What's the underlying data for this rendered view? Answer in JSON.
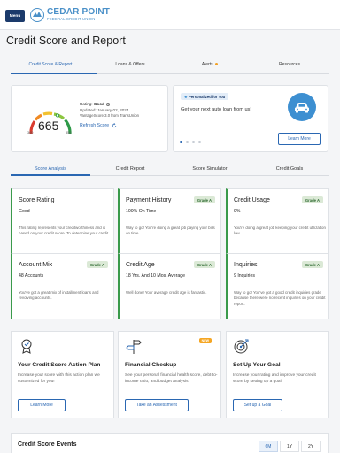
{
  "header": {
    "menu_label": "Menu",
    "logo_line1": "CEDAR POINT",
    "logo_line2": "FEDERAL CREDIT UNION"
  },
  "page_title": "Credit Score and Report",
  "main_tabs": [
    {
      "label": "Credit Score & Report",
      "active": true
    },
    {
      "label": "Loans & Offers"
    },
    {
      "label": "Alerts"
    },
    {
      "label": "Resources"
    }
  ],
  "score_card": {
    "score": "665",
    "min": "300",
    "max": "850",
    "rating_label": "Rating:",
    "rating_value": "Good",
    "updated": "Updated: January 02, 2024",
    "source": "VantageScore 3.0 from TransUnion",
    "refresh_label": "Refresh Score"
  },
  "promo": {
    "badge": "Personalized for You",
    "text": "Get your next auto loan from us!",
    "button": "Learn More",
    "slide_count": 4,
    "active_slide": 0
  },
  "sub_tabs": [
    {
      "label": "Score Analysis",
      "active": true
    },
    {
      "label": "Credit Report"
    },
    {
      "label": "Score Simulator"
    },
    {
      "label": "Credit Goals"
    }
  ],
  "metrics": [
    {
      "title": "Score Rating",
      "value": "Good",
      "grade": "",
      "desc": "This rating represents your creditworthiness and is based on your credit score. To determine your credit..."
    },
    {
      "title": "Payment History",
      "value": "100% On Time",
      "grade": "Grade A",
      "desc": "Way to go! You're doing a great job paying your bills on time."
    },
    {
      "title": "Credit Usage",
      "value": "9%",
      "grade": "Grade A",
      "desc": "You're doing a great job keeping your credit utilization low."
    },
    {
      "title": "Account Mix",
      "value": "48 Accounts",
      "grade": "Grade A",
      "desc": "You've got a great mix of installment loans and revolving accounts."
    },
    {
      "title": "Credit Age",
      "value": "18 Yrs. And 10 Mos. Average",
      "grade": "Grade A",
      "desc": "Well done! Your average credit age is fantastic."
    },
    {
      "title": "Inquiries",
      "value": "9 Inquiries",
      "grade": "Grade A",
      "desc": "Way to go! You've got a good credit inquiries grade because there were no recent inquiries on your credit report."
    }
  ],
  "features": [
    {
      "title": "Your Credit Score Action Plan",
      "desc": "Increase your score with this action plan we customized for you!",
      "button": "Learn More",
      "icon": "trophy-icon",
      "badge": ""
    },
    {
      "title": "Financial Checkup",
      "desc": "See your personal financial health score, debt-to-income ratio, and budget analysis.",
      "button": "Take an Assessment",
      "icon": "signpost-icon",
      "badge": "NEW"
    },
    {
      "title": "Set Up Your Goal",
      "desc": "Increase your rating and improve your credit score by setting up a goal.",
      "button": "Set up a Goal",
      "icon": "target-icon",
      "badge": ""
    }
  ],
  "events": {
    "title": "Credit Score Events",
    "ranges": [
      {
        "label": "6M",
        "active": true
      },
      {
        "label": "1Y"
      },
      {
        "label": "2Y"
      }
    ]
  },
  "colors": {
    "brand": "#1b3a6b",
    "accent": "#2a67b2",
    "grade_bg": "#dbe9d6",
    "grade_text": "#2f6b32",
    "metric_border": "#3a9a4b",
    "new_badge": "#f5a623"
  }
}
